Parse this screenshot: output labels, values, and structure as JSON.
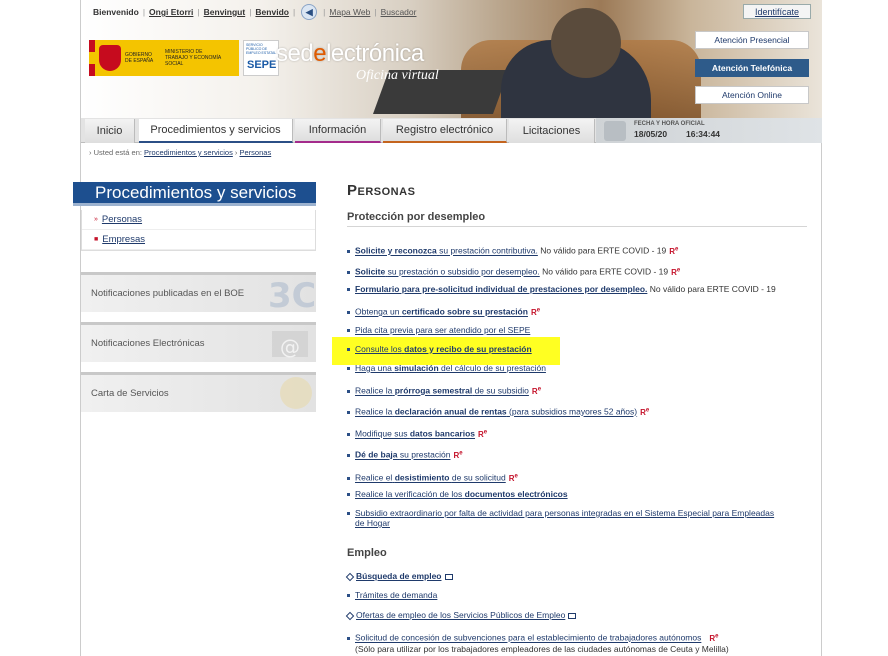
{
  "topnav": {
    "welcome": "Bienvenido",
    "lang1": "Ongi Etorri",
    "lang2": "Benvingut",
    "lang3": "Benvido",
    "mapa": "Mapa Web",
    "buscador": "Buscador",
    "identify": "Identifícate"
  },
  "header": {
    "gov1": "GOBIERNO DE ESPAÑA",
    "gov2": "MINISTERIO DE TRABAJO Y ECONOMÍA SOCIAL",
    "sepe_small": "SERVICIO PÚBLICO DE EMPLEO ESTATAL",
    "sepe": "SEPE",
    "brand_a": "sed",
    "brand_e": "e",
    "brand_b": "lectrónica",
    "brand_sub": "Oficina virtual",
    "btn_presencial": "Atención Presencial",
    "btn_telefonica": "Atención Telefónica",
    "btn_online": "Atención Online"
  },
  "tabs": [
    "Inicio",
    "Procedimientos y servicios",
    "Información",
    "Registro electrónico",
    "Licitaciones"
  ],
  "datetime": {
    "label": "FECHA Y HORA OFICIAL",
    "date": "18/05/20",
    "time": "16:34:44"
  },
  "breadcrumb": {
    "prefix": "› Usted está en:",
    "item1": "Procedimientos y servicios",
    "item2": "Personas"
  },
  "sidebar": {
    "title": "Procedimientos y servicios",
    "items": [
      "Personas",
      "Empresas"
    ],
    "box1": "Notificaciones publicadas en el BOE",
    "box2": "Notificaciones Electrónicas",
    "box3": "Carta de Servicios"
  },
  "main": {
    "title": "Personas",
    "section1": "Protección por desempleo",
    "l1a": "Solicite y reconozca",
    "l1b": "su prestación contributiva.",
    "l1c": "No válido para ERTE COVID - 19",
    "l2a": "Solicite",
    "l2b": "su prestación o subsidio por desempleo.",
    "l2c": "No válido para ERTE COVID - 19",
    "l3a": "Formulario para pre-solicitud individual de prestaciones por desempleo.",
    "l3c": "No válido para ERTE COVID - 19",
    "l4a": "Obtenga un",
    "l4b": "certificado sobre su prestación",
    "l5": "Pida cita previa para ser atendido por el SEPE",
    "l6a": "Consulte los",
    "l6b": "datos y recibo de su prestación",
    "l7a": "Haga una",
    "l7b": "simulación",
    "l7c": "del cálculo de su prestación",
    "l8a": "Realice la",
    "l8b": "prórroga semestral",
    "l8c": "de su subsidio",
    "l9a": "Realice la",
    "l9b": "declaración anual de rentas",
    "l9c": "(para subsidios mayores 52 años)",
    "l10a": "Modifique sus",
    "l10b": "datos bancarios",
    "l11a": "Dé de baja",
    "l11b": "su prestación",
    "l12a": "Realice el",
    "l12b": "desistimiento",
    "l12c": "de su solicitud",
    "l13a": "Realice la verificación de los",
    "l13b": "documentos electrónicos",
    "l14a": "Subsidio extraordinario por falta de actividad para personas integradas en el Sistema Especial para Empleadas",
    "l14b": "de Hogar",
    "section2": "Empleo",
    "e1": "Búsqueda de empleo",
    "e2": "Trámites de demanda",
    "e3": "Ofertas de empleo de los Servicios Públicos de Empleo",
    "e4": "Solicitud de concesión de subvenciones para el establecimiento de trabajadores autónomos",
    "e4b": "(Sólo para utilizar por los trabajadores empleadores de las ciudades autónomas de Ceuta y Melilla)",
    "re": "R",
    "re_sup": "e"
  }
}
